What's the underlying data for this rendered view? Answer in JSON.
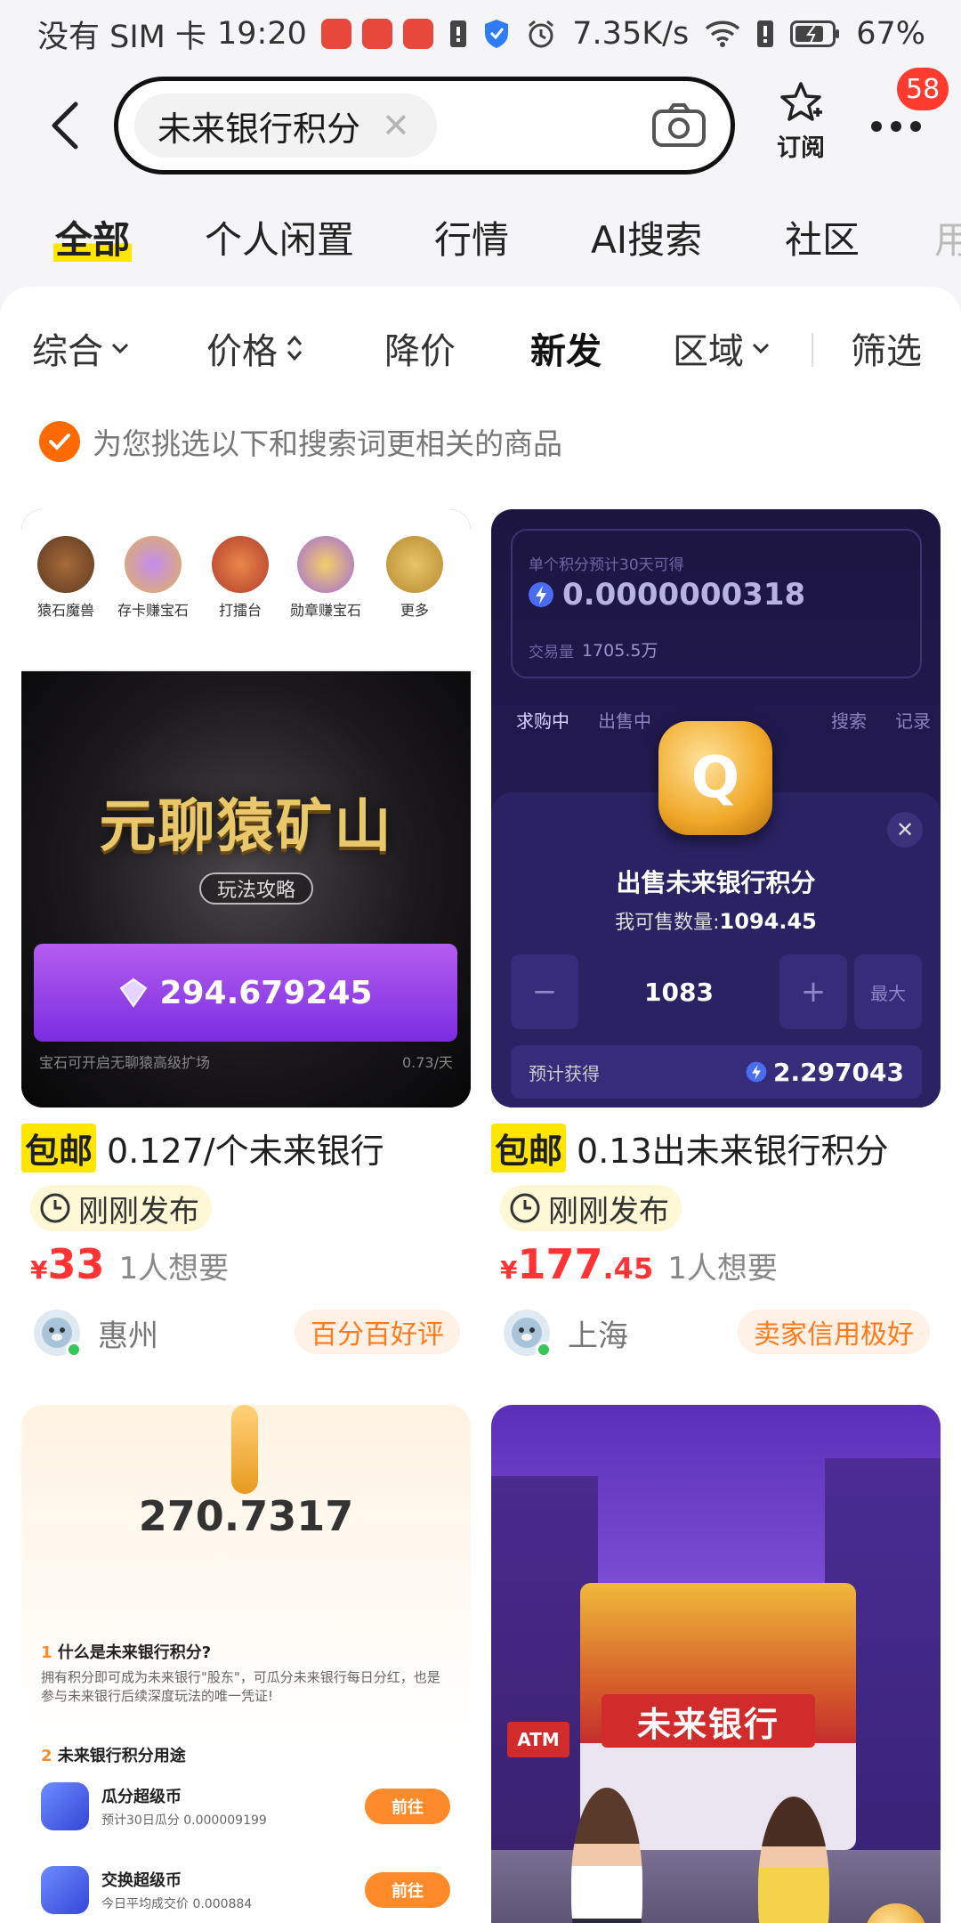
{
  "status_bar": {
    "carrier": "没有 SIM 卡",
    "time": "19:20",
    "net_speed": "7.35K/s",
    "battery": "67%"
  },
  "search": {
    "query": "未来银行积分",
    "subscribe_label": "订阅",
    "notification_count": "58"
  },
  "category_tabs": [
    "全部",
    "个人闲置",
    "行情",
    "AI搜索",
    "社区",
    "用"
  ],
  "sort_bar": {
    "overall": "综合",
    "price": "价格",
    "price_drop": "降价",
    "newest": "新发",
    "region": "区域",
    "filter": "筛选"
  },
  "hint": "为您挑选以下和搜索词更相关的商品",
  "products": [
    {
      "free_shipping": "包邮",
      "title": "0.127/个未来银行",
      "fresh": "刚刚发布",
      "currency": "¥",
      "price_int": "33",
      "price_dec": "",
      "wants": "1人想要",
      "city": "惠州",
      "rating": "百分百好评",
      "image": {
        "icons": [
          "猿石魔兽",
          "存卡赚宝石",
          "打擂台",
          "勋章赚宝石",
          "更多"
        ],
        "game_title": "元聊猿矿山",
        "guide": "玩法攻略",
        "gem_value": "294.679245",
        "footer_left": "宝石可开启无聊猿高级扩场",
        "footer_right": "0.73/天"
      }
    },
    {
      "free_shipping": "包邮",
      "title": "0.13出未来银行积分",
      "fresh": "刚刚发布",
      "currency": "¥",
      "price_int": "177",
      "price_dec": ".45",
      "wants": "1人想要",
      "city": "上海",
      "rating": "卖家信用极好",
      "image": {
        "box_label": "单个积分预计30天可得",
        "box_value": "0.0000000318",
        "volume_label": "交易量",
        "volume_value": "1705.5万",
        "tab_buy": "求购中",
        "tab_sell": "出售中",
        "tab_search": "搜索",
        "tab_record": "记录",
        "modal_title": "出售未来银行积分",
        "sellable_label": "我可售数量:",
        "sellable_value": "1094.45",
        "stepper_minus": "−",
        "stepper_value": "1083",
        "stepper_plus": "+",
        "stepper_max": "最大",
        "est_label": "预计获得",
        "est_value": "2.297043"
      }
    },
    {
      "image": {
        "number": "270.7317",
        "q1": "什么是未来银行积分?",
        "q1_text": "拥有积分即可成为未来银行\"股东\"，可瓜分未来银行每日分红，也是参与未来银行后续深度玩法的唯一凭证!",
        "q2": "未来银行积分用途",
        "rows": [
          {
            "title": "瓜分超级币",
            "sub": "预计30日瓜分 0.000009199",
            "btn": "前往"
          },
          {
            "title": "交换超级币",
            "sub": "今日平均成交价 0.000884",
            "btn": "前往"
          }
        ]
      }
    },
    {
      "image": {
        "sign": "未来银行",
        "atm": "ATM"
      }
    }
  ]
}
